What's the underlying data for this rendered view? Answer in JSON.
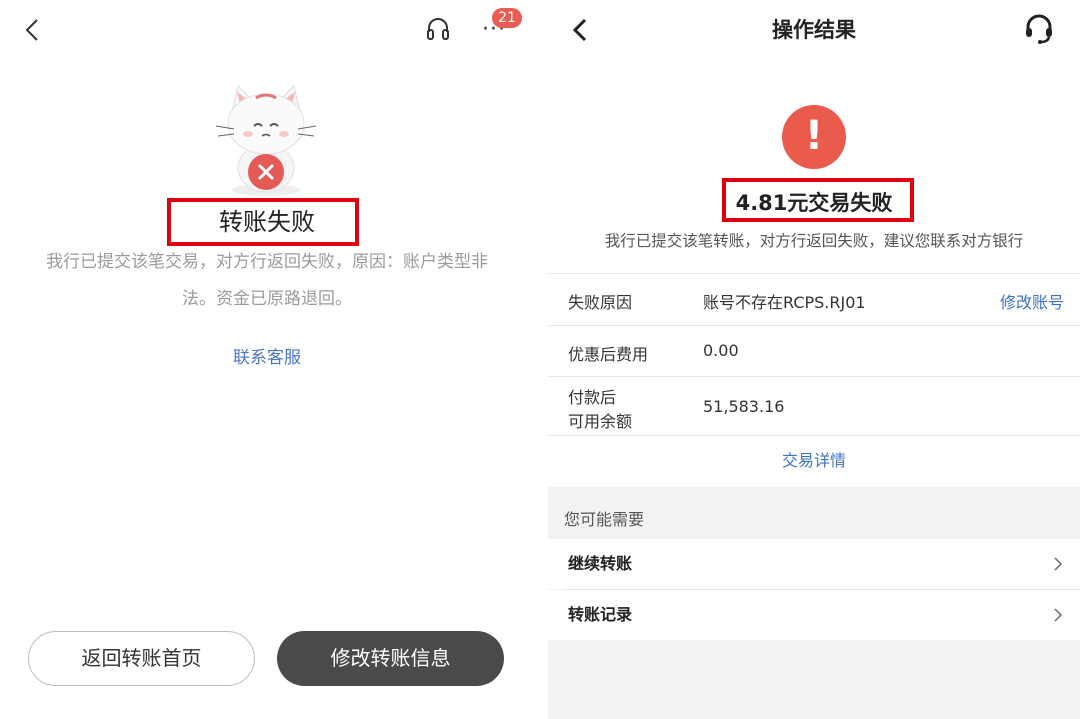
{
  "left": {
    "badge_count": "21",
    "more_icon_text": "···",
    "title": "转账失败",
    "description": "我行已提交该笔交易，对方行返回失败，原因：账户类型非法。资金已原路退回。",
    "contact_link": "联系客服",
    "buttons": {
      "back_home": "返回转账首页",
      "modify": "修改转账信息"
    },
    "colors": {
      "highlight_box": "#e00010",
      "link": "#4a76c9",
      "dark_button": "#4a4a4a"
    }
  },
  "right": {
    "header_title": "操作结果",
    "alert_symbol": "!",
    "status": "4.81元交易失败",
    "subtitle": "我行已提交该笔转账，对方行返回失败，建议您联系对方银行",
    "rows": [
      {
        "label": "失败原因",
        "value": "账号不存在RCPS.RJ01",
        "action": "修改账号"
      },
      {
        "label": "优惠后费用",
        "value": "0.00"
      },
      {
        "label_line1": "付款后",
        "label_line2": "可用余额",
        "value": "51,583.16"
      }
    ],
    "detail_link": "交易详情",
    "section_title": "您可能需要",
    "suggestions": [
      {
        "label": "继续转账"
      },
      {
        "label": "转账记录"
      }
    ],
    "colors": {
      "alert": "#ea5b4c",
      "link": "#3e72c9",
      "section_bg": "#f2f2f2"
    }
  }
}
